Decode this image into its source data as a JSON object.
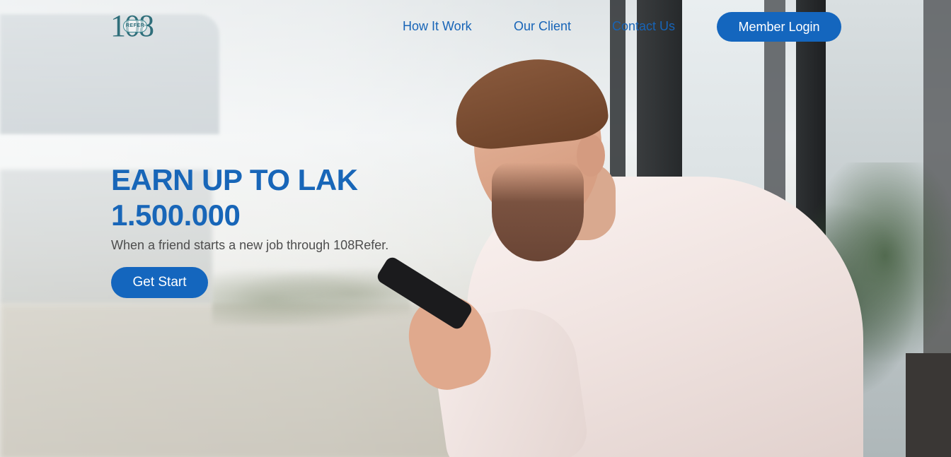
{
  "brand": {
    "logo_number": "108",
    "logo_badge": "REFER"
  },
  "nav": {
    "items": [
      {
        "label": "How It Work"
      },
      {
        "label": "Our Client"
      },
      {
        "label": "Contact Us"
      }
    ],
    "login_label": "Member Login"
  },
  "hero": {
    "title": "EARN UP TO LAK 1.500.000",
    "subtitle": "When a friend starts a new job through 108Refer.",
    "cta_label": "Get Start",
    "image": "man-with-phone-photo"
  },
  "colors": {
    "accent": "#1466be",
    "heading": "#1866b8",
    "body_text": "#4d4d4d"
  }
}
